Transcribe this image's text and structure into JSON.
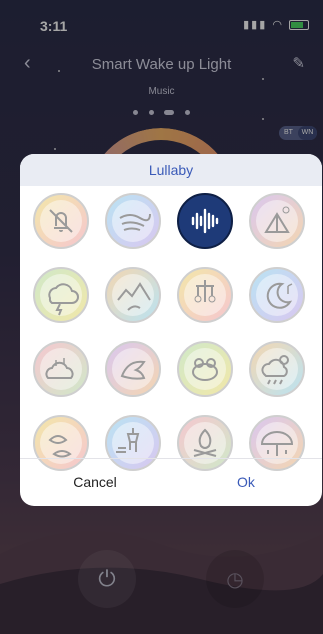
{
  "status": {
    "time": "3:11"
  },
  "nav": {
    "title": "Smart Wake up Light",
    "back_icon": "chevron-left-icon",
    "edit_icon": "pencil-icon"
  },
  "subtitle": "Music",
  "pager": {
    "count": 4,
    "active": 3
  },
  "toggle": {
    "left": "BT",
    "right": "WN"
  },
  "dialog": {
    "title": "Lullaby",
    "cancel_label": "Cancel",
    "ok_label": "Ok",
    "selected_index": 2,
    "sounds": [
      {
        "icon": "bell-off-icon"
      },
      {
        "icon": "wind-icon"
      },
      {
        "icon": "soundwave-icon"
      },
      {
        "icon": "tent-night-icon"
      },
      {
        "icon": "thunderstorm-icon"
      },
      {
        "icon": "river-valley-icon"
      },
      {
        "icon": "baby-mobile-icon"
      },
      {
        "icon": "moon-music-icon"
      },
      {
        "icon": "cloud-music-icon"
      },
      {
        "icon": "bird-icon"
      },
      {
        "icon": "frog-icon"
      },
      {
        "icon": "sun-rain-icon"
      },
      {
        "icon": "leaves-wind-icon"
      },
      {
        "icon": "wind-chime-icon"
      },
      {
        "icon": "campfire-icon"
      },
      {
        "icon": "rain-umbrella-icon"
      }
    ]
  },
  "colors": {
    "accent": "#3a5ab8",
    "selected_fill": "#1e3a78"
  },
  "buttons": {
    "power_icon": "power-icon",
    "clock_icon": "clock-icon"
  }
}
